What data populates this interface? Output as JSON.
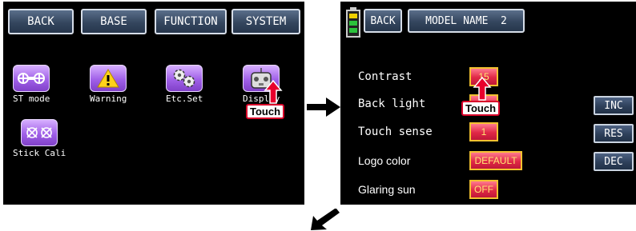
{
  "left_screen": {
    "tabs": [
      {
        "label": "BACK"
      },
      {
        "label": "BASE"
      },
      {
        "label": "FUNCTION"
      },
      {
        "label": "SYSTEM"
      }
    ],
    "icons": [
      {
        "label": "ST mode",
        "icon": "drone-icon"
      },
      {
        "label": "Warning",
        "icon": "warning-icon"
      },
      {
        "label": "Etc.Set",
        "icon": "gears-icon"
      },
      {
        "label": "Display",
        "icon": "controller-icon"
      },
      {
        "label": "Stick Cali",
        "icon": "stick-calibration-icon"
      }
    ],
    "touch_label": "Touch"
  },
  "right_screen": {
    "back_label": "BACK",
    "model_name": "MODEL NAME  2",
    "settings": [
      {
        "label": "Contrast",
        "value": "15"
      },
      {
        "label": "Back light",
        "value": "1"
      },
      {
        "label": "Touch sense",
        "value": "1"
      },
      {
        "label": "Logo color",
        "value": "DEFAULT"
      },
      {
        "label": "Glaring sun",
        "value": "OFF"
      }
    ],
    "side_buttons": {
      "inc": "INC",
      "res": "RES",
      "dec": "DEC"
    },
    "touch_label": "Touch"
  },
  "colors": {
    "screen_bg": "#000000",
    "tab_blue": "#34465e",
    "icon_purple": "#a060e8",
    "value_red": "#e02846",
    "value_text_yellow": "#ffe873",
    "touch_border": "#d8002a"
  }
}
